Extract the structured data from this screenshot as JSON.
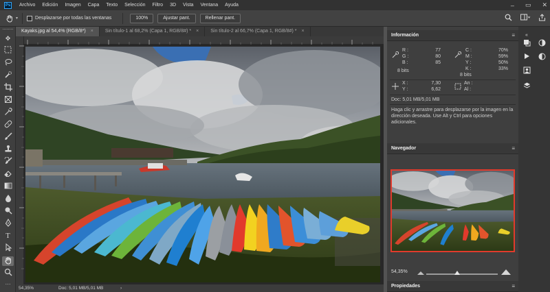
{
  "app": {
    "logo": "Ps",
    "menu": [
      "Archivo",
      "Edición",
      "Imagen",
      "Capa",
      "Texto",
      "Selección",
      "Filtro",
      "3D",
      "Vista",
      "Ventana",
      "Ayuda"
    ],
    "window_controls": [
      "–",
      "▭",
      "✕"
    ]
  },
  "options_bar": {
    "tool_icon": "hand-icon",
    "scroll_all_label": "Desplazarse por todas las ventanas",
    "zoom_button": "100%",
    "fit_button": "Ajustar pant.",
    "fill_button": "Rellenar pant.",
    "right_icons": [
      "search-icon",
      "workspace-icon",
      "share-icon"
    ]
  },
  "tabs": [
    {
      "label": "Kayaks.jpg al 54,4% (RGB/8*)",
      "close": "×",
      "active": true
    },
    {
      "label": "Sin título-1 al 68,2% (Capa 1, RGB/8#) *",
      "close": "×",
      "active": false
    },
    {
      "label": "Sin título-2 al 66,7% (Capa 1, RGB/8#) *",
      "close": "×",
      "active": false
    }
  ],
  "status": {
    "zoom": "54,35%",
    "doc": "Doc: 5,01 MB/5,01 MB",
    "arrow": "›"
  },
  "info_panel": {
    "title": "Información",
    "menu": "≡",
    "rgb": {
      "R_label": "R :",
      "R": "77",
      "G_label": "G :",
      "G": "80",
      "B_label": "B :",
      "B": "85",
      "bits": "8 bits"
    },
    "cmyk": {
      "C_label": "C :",
      "C": "70%",
      "M_label": "M :",
      "M": "59%",
      "Y_label": "Y :",
      "Y": "50%",
      "K_label": "K :",
      "K": "33%",
      "bits": "8 bits"
    },
    "coords": {
      "X_label": "X :",
      "X": "7,30",
      "Y_label": "Y :",
      "Y": "6,62"
    },
    "size": {
      "W_label": "An :",
      "H_label": "Al :"
    },
    "doc": "Doc: 5,01 MB/5,01 MB",
    "hint": "Haga clic y arrastre para desplazarse por la imagen en la dirección deseada. Use Alt y Ctrl para opciones adicionales."
  },
  "navigator_panel": {
    "title": "Navegador",
    "menu": "≡",
    "zoom": "54,35%"
  },
  "properties_panel": {
    "title": "Propiedades",
    "menu": "≡"
  },
  "icons": {
    "toolbar": [
      "move-icon",
      "marquee-icon",
      "lasso-icon",
      "quick-select-icon",
      "crop-icon",
      "frame-icon",
      "eyedropper-icon",
      "healing-brush-icon",
      "brush-icon",
      "clone-stamp-icon",
      "history-brush-icon",
      "eraser-icon",
      "gradient-icon",
      "blur-icon",
      "dodge-icon",
      "pen-icon",
      "type-icon",
      "path-select-icon",
      "rectangle-icon",
      "hand-icon",
      "zoom-icon",
      "more-tools-icon"
    ],
    "dock": [
      "color-icon",
      "swatches-icon",
      "play-icon",
      "libraries-icon",
      "adjust-icon",
      "patterns-icon",
      "layers-icon",
      "channels-icon",
      "info-icon",
      "navigator-icon"
    ]
  },
  "colors": {
    "accent_red": "#e23a2c",
    "panel_bg": "#3f3f3f",
    "menu_bg": "#323232"
  }
}
